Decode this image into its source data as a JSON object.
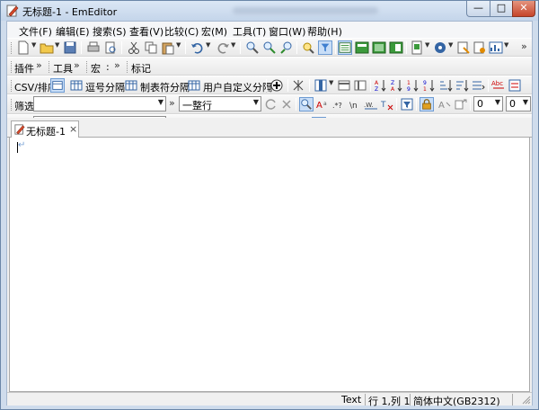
{
  "window": {
    "title": "无标题-1 - EmEditor",
    "minimize": "—",
    "maximize": "□",
    "close": "✕"
  },
  "menu": [
    "文件(F)",
    "编辑(E)",
    "搜索(S)",
    "查看(V)",
    "比较(C)",
    "宏(M)",
    "工具(T)",
    "窗口(W)",
    "帮助(H)"
  ],
  "toolbars": {
    "plugins": "插件",
    "tools": "工具",
    "macro": "宏",
    "bookmark": "标记",
    "more": "»"
  },
  "csv": {
    "label": "CSV/排序",
    "comma": "逗号分隔",
    "tab": "制表符分隔",
    "custom": "用户自定义分隔"
  },
  "filter": {
    "label": "筛选",
    "value": "",
    "mode": "一整行",
    "num1": "0",
    "num2": "0"
  },
  "find": {
    "label": "查找",
    "value": ""
  },
  "document_tab": {
    "label": "无标题-1",
    "close": "×"
  },
  "status": {
    "mode": "Text",
    "position": "行 1,列 1",
    "encoding": "简体中文(GB2312)"
  },
  "colors": {
    "title_bg": "#c4d5ea",
    "close_button": "#c6452b",
    "active_button": "#c9def7"
  }
}
